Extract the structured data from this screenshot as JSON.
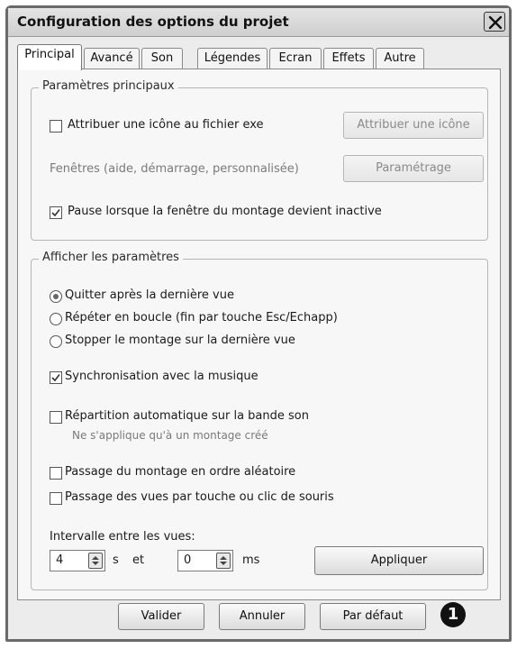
{
  "window": {
    "title": "Configuration des options du projet"
  },
  "tabs": [
    {
      "label": "Principal"
    },
    {
      "label": "Avancé"
    },
    {
      "label": "Son"
    },
    {
      "label": "Légendes"
    },
    {
      "label": "Ecran"
    },
    {
      "label": "Effets"
    },
    {
      "label": "Autre"
    }
  ],
  "main_params": {
    "title": "Paramètres principaux",
    "assign_icon": {
      "label": "Attribuer une icône au fichier exe",
      "checked": false
    },
    "assign_icon_button": "Attribuer une icône",
    "windows_label": "Fenêtres (aide, démarrage, personnalisée)",
    "setup_button": "Paramétrage",
    "pause": {
      "label": "Pause lorsque la fenêtre du montage devient inactive",
      "checked": true
    }
  },
  "display_params": {
    "title": "Afficher les paramètres",
    "radios": [
      {
        "label": "Quitter après la dernière vue",
        "selected": true
      },
      {
        "label": "Répéter en boucle (fin par touche Esc/Echapp)",
        "selected": false
      },
      {
        "label": "Stopper le montage sur la dernière vue",
        "selected": false
      }
    ],
    "sync_music": {
      "label": "Synchronisation avec la musique",
      "checked": true
    },
    "auto_distribution": {
      "label": "Répartition automatique sur la bande son",
      "checked": false
    },
    "auto_note": "Ne s'applique qu'à un montage créé",
    "random_order": {
      "label": "Passage du montage en ordre aléatoire",
      "checked": false
    },
    "key_click": {
      "label": "Passage des vues par touche ou clic de souris",
      "checked": false
    },
    "interval_label": "Intervalle entre les vues:",
    "seconds_value": "4",
    "seconds_unit": "s",
    "and_label": "et",
    "ms_value": "0",
    "ms_unit": "ms",
    "apply_button": "Appliquer"
  },
  "footer": {
    "validate_button": "Valider",
    "cancel_button": "Annuler",
    "default_button": "Par défaut",
    "marker": "1"
  }
}
